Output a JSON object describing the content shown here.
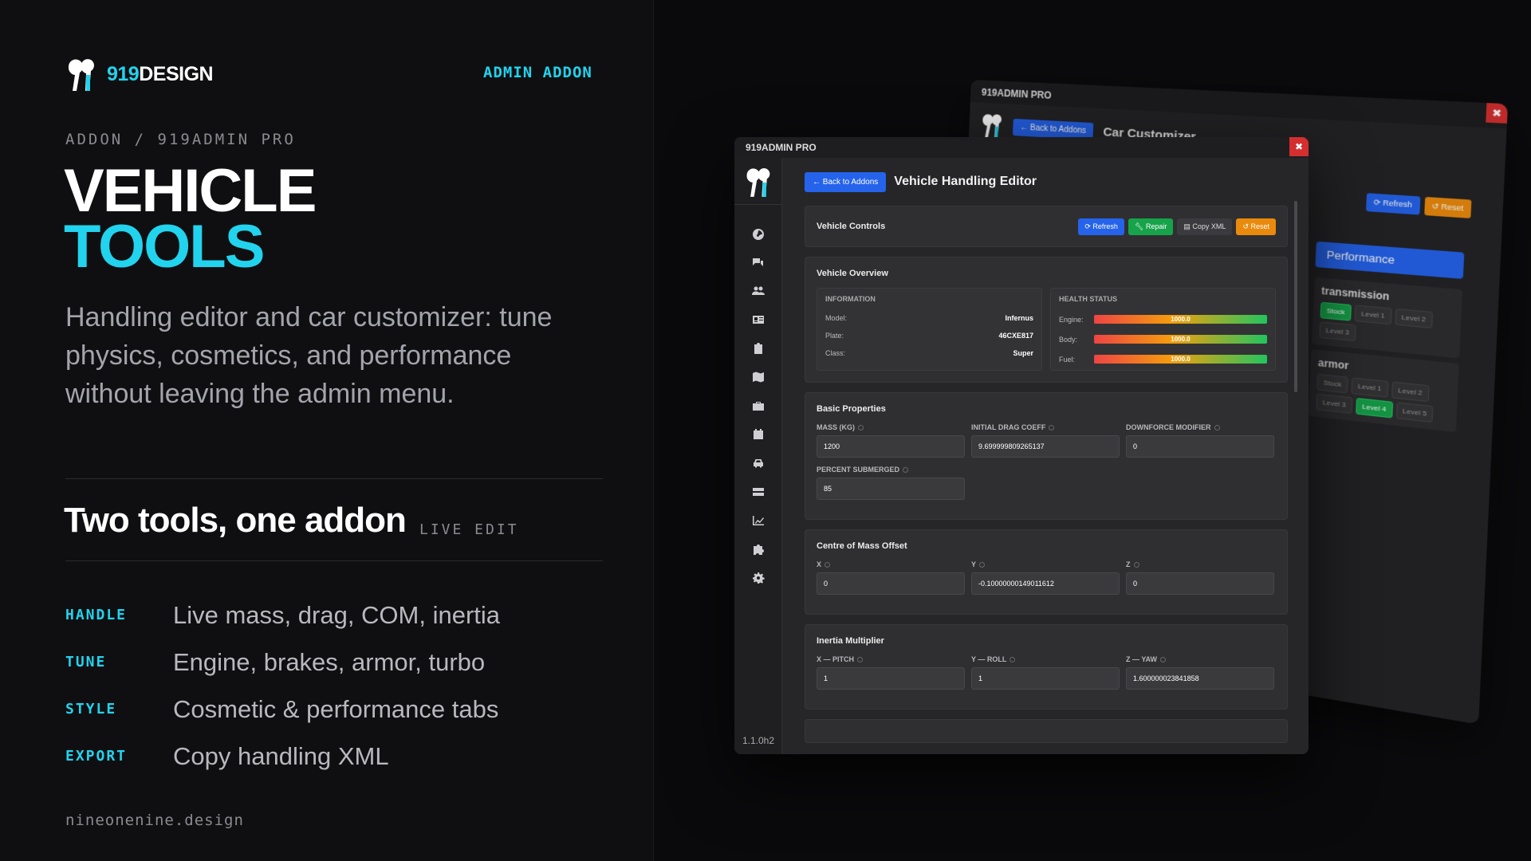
{
  "brand": {
    "name_accent": "919",
    "name_rest": "DESIGN"
  },
  "header": {
    "tag": "ADMIN ADDON"
  },
  "breadcrumb": "ADDON / 919ADMIN PRO",
  "hero": {
    "line1": "VEHICLE",
    "line2": "TOOLS"
  },
  "lede": "Handling editor and car customizer: tune physics, cosmetics, and performance without leaving the admin menu.",
  "section": {
    "title": "Two tools, one addon",
    "tag": "LIVE EDIT"
  },
  "features": [
    {
      "key": "HANDLE",
      "text": "Live mass, drag, COM, inertia"
    },
    {
      "key": "TUNE",
      "text": "Engine, brakes, armor, turbo"
    },
    {
      "key": "STYLE",
      "text": "Cosmetic & performance tabs"
    },
    {
      "key": "EXPORT",
      "text": "Copy handling XML"
    }
  ],
  "footer": "nineonenine.design",
  "back_window": {
    "title": "919ADMIN PRO",
    "back_label": "← Back to Addons",
    "page_title": "Car Customizer",
    "refresh": "Refresh",
    "reset": "Reset",
    "performance": "Performance",
    "transmission": {
      "title": "transmission",
      "levels": [
        "Stock",
        "Level 1",
        "Level 2",
        "Level 3"
      ],
      "selected": "Stock"
    },
    "armor": {
      "title": "armor",
      "levels": [
        "Stock",
        "Level 1",
        "Level 2",
        "Level 3",
        "Level 4",
        "Level 5"
      ],
      "selected": "Level 4"
    }
  },
  "window": {
    "title": "919ADMIN PRO",
    "close": "✖",
    "back_label": "← Back to Addons",
    "page_title": "Vehicle Handling Editor",
    "version": "1.1.0h2",
    "controls": {
      "title": "Vehicle Controls",
      "refresh": "Refresh",
      "repair": "Repair",
      "copy_xml": "Copy XML",
      "reset": "Reset"
    },
    "overview": {
      "title": "Vehicle Overview",
      "info_header": "Information",
      "info": [
        {
          "label": "Model:",
          "value": "Infernus"
        },
        {
          "label": "Plate:",
          "value": "46CXE817"
        },
        {
          "label": "Class:",
          "value": "Super"
        }
      ],
      "health_header": "Health Status",
      "health": [
        {
          "label": "Engine:",
          "value": "1000.0"
        },
        {
          "label": "Body:",
          "value": "1000.0"
        },
        {
          "label": "Fuel:",
          "value": "1000.0"
        }
      ]
    },
    "basic": {
      "title": "Basic Properties",
      "fields": [
        {
          "label": "Mass (KG)",
          "value": "1200"
        },
        {
          "label": "Initial Drag Coeff",
          "value": "9.699999809265137"
        },
        {
          "label": "Downforce Modifier",
          "value": "0"
        },
        {
          "label": "Percent Submerged",
          "value": "85"
        }
      ]
    },
    "com": {
      "title": "Centre of Mass Offset",
      "fields": [
        {
          "label": "X",
          "value": "0"
        },
        {
          "label": "Y",
          "value": "-0.10000000149011612"
        },
        {
          "label": "Z",
          "value": "0"
        }
      ]
    },
    "inertia": {
      "title": "Inertia Multiplier",
      "fields": [
        {
          "label": "X — Pitch",
          "value": "1"
        },
        {
          "label": "Y — Roll",
          "value": "1"
        },
        {
          "label": "Z — Yaw",
          "value": "1.600000023841858"
        }
      ]
    }
  },
  "colors": {
    "accent": "#22d3ee",
    "primary": "#2563eb",
    "success": "#16a34a",
    "warning": "#ea8a0c",
    "danger": "#d32f2f"
  },
  "sidebar_icons": [
    "dashboard-icon",
    "chat-icon",
    "players-icon",
    "id-card-icon",
    "clipboard-icon",
    "map-icon",
    "briefcase-icon",
    "calendar-icon",
    "car-icon",
    "server-icon",
    "chart-icon",
    "puzzle-icon",
    "gear-icon"
  ]
}
